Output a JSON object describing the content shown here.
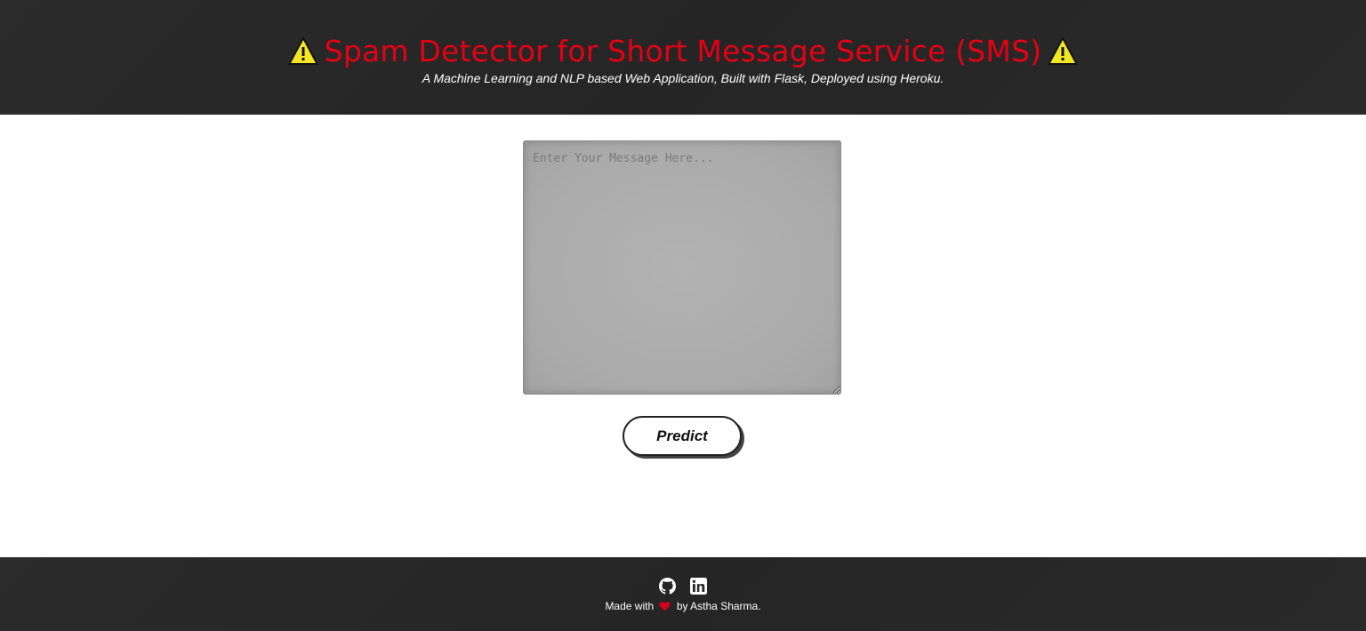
{
  "header": {
    "title": "Spam Detector for Short Message Service (SMS)",
    "subtitle": "A Machine Learning and NLP based Web Application, Built with Flask, Deployed using Heroku.",
    "left_icon": "warning-icon",
    "right_icon": "warning-icon",
    "title_color": "#e60013"
  },
  "form": {
    "message_placeholder": "Enter Your Message Here...",
    "message_value": "",
    "predict_label": "Predict"
  },
  "footer": {
    "social": [
      {
        "icon": "github-icon"
      },
      {
        "icon": "linkedin-icon"
      }
    ],
    "credit_prefix": "Made with",
    "credit_icon": "heart-icon",
    "credit_suffix": "by Astha Sharma."
  }
}
